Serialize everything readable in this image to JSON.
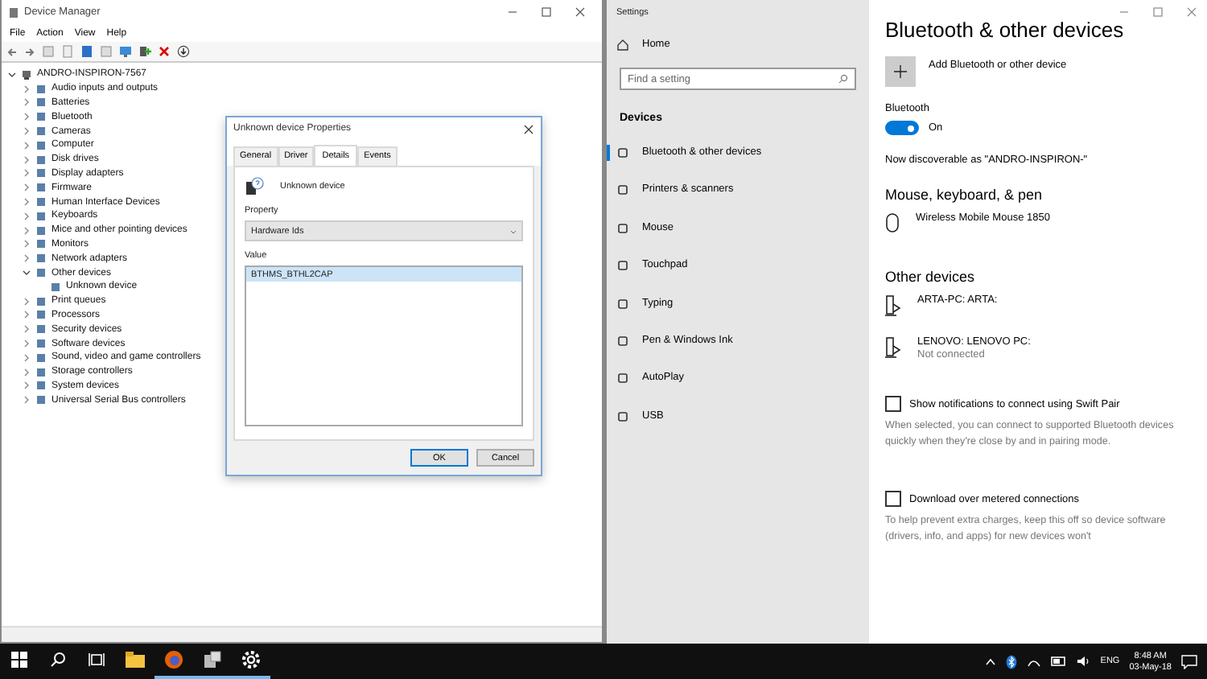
{
  "device_manager": {
    "title": "Device Manager",
    "menu": [
      "File",
      "Action",
      "View",
      "Help"
    ],
    "tree": {
      "label": "ANDRO-INSPIRON-7567",
      "expanded": true,
      "children": [
        {
          "label": "Audio inputs and outputs",
          "expanded": false
        },
        {
          "label": "Batteries",
          "expanded": false
        },
        {
          "label": "Bluetooth",
          "expanded": false
        },
        {
          "label": "Cameras",
          "expanded": false
        },
        {
          "label": "Computer",
          "expanded": false
        },
        {
          "label": "Disk drives",
          "expanded": false
        },
        {
          "label": "Display adapters",
          "expanded": false
        },
        {
          "label": "Firmware",
          "expanded": false
        },
        {
          "label": "Human Interface Devices",
          "expanded": false
        },
        {
          "label": "Keyboards",
          "expanded": false
        },
        {
          "label": "Mice and other pointing devices",
          "expanded": false
        },
        {
          "label": "Monitors",
          "expanded": false
        },
        {
          "label": "Network adapters",
          "expanded": false
        },
        {
          "label": "Other devices",
          "expanded": true,
          "children": [
            {
              "label": "Unknown device"
            }
          ]
        },
        {
          "label": "Print queues",
          "expanded": false
        },
        {
          "label": "Processors",
          "expanded": false
        },
        {
          "label": "Security devices",
          "expanded": false
        },
        {
          "label": "Software devices",
          "expanded": false
        },
        {
          "label": "Sound, video and game controllers",
          "expanded": false
        },
        {
          "label": "Storage controllers",
          "expanded": false
        },
        {
          "label": "System devices",
          "expanded": false
        },
        {
          "label": "Universal Serial Bus controllers",
          "expanded": false
        }
      ]
    }
  },
  "dialog": {
    "title": "Unknown device Properties",
    "tabs": [
      {
        "label": "General",
        "selected": false
      },
      {
        "label": "Driver",
        "selected": false
      },
      {
        "label": "Details",
        "selected": true
      },
      {
        "label": "Events",
        "selected": false
      }
    ],
    "device_name": "Unknown device",
    "property_label": "Property",
    "property_value": "Hardware Ids",
    "value_label": "Value",
    "values": [
      {
        "text": "BTHMS_BTHL2CAP",
        "selected": true
      }
    ],
    "buttons": [
      {
        "label": "OK",
        "default": true
      },
      {
        "label": "Cancel",
        "default": false
      }
    ]
  },
  "settings": {
    "title": "Settings",
    "home": "Home",
    "search": {
      "placeholder": "Find a setting"
    },
    "section": "Devices",
    "nav": [
      {
        "label": "Bluetooth & other devices",
        "selected": true
      },
      {
        "label": "Printers & scanners",
        "selected": false
      },
      {
        "label": "Mouse",
        "selected": false
      },
      {
        "label": "Touchpad",
        "selected": false
      },
      {
        "label": "Typing",
        "selected": false
      },
      {
        "label": "Pen & Windows Ink",
        "selected": false
      },
      {
        "label": "AutoPlay",
        "selected": false
      },
      {
        "label": "USB",
        "selected": false
      }
    ],
    "heading": "Bluetooth & other devices",
    "add_device": "Add Bluetooth or other device",
    "bluetooth": {
      "label": "Bluetooth",
      "on": true,
      "state": "On"
    },
    "discoverable": "Now discoverable as \"ANDRO-INSPIRON-\"",
    "mouse_section": "Mouse, keyboard, & pen",
    "mouse_devices": [
      {
        "name": "Wireless Mobile Mouse 1850"
      }
    ],
    "other_section": "Other devices",
    "other_devices": [
      {
        "name": "ARTA-PC: ARTA:"
      },
      {
        "name": "LENOVO: LENOVO PC:",
        "status": "Not connected"
      }
    ],
    "options": [
      {
        "label": "Show notifications to connect using Swift Pair",
        "checked": false,
        "description": "When selected, you can connect to supported Bluetooth devices quickly when they're close by and in pairing mode."
      },
      {
        "label": "Download over metered connections",
        "checked": false,
        "description": "To help prevent extra charges, keep this off so device software (drivers, info, and apps) for new devices won't"
      }
    ]
  },
  "taskbar": {
    "apps": [
      {
        "kind": "explorer",
        "running": false
      },
      {
        "kind": "firefox",
        "running": true
      },
      {
        "kind": "devmgr",
        "running": true
      },
      {
        "kind": "settings",
        "running": true
      }
    ],
    "language": "ENG",
    "time": "8:48 AM",
    "date": "03-May-18"
  }
}
